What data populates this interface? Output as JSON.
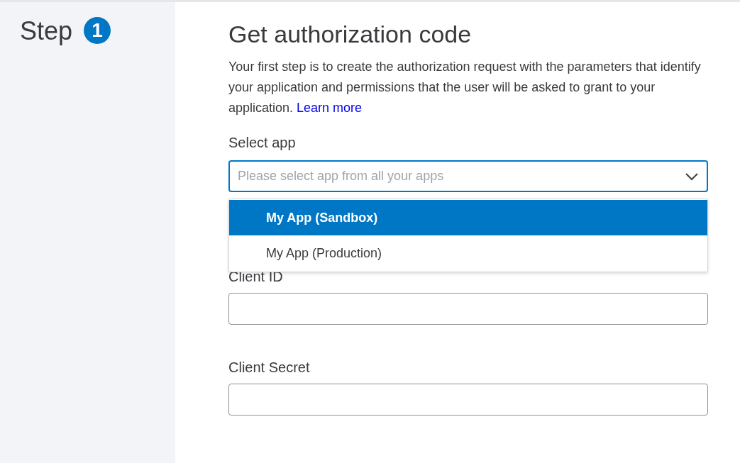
{
  "sidebar": {
    "step_label": "Step",
    "step_number": "1"
  },
  "heading": "Get authorization code",
  "intro": {
    "text": "Your first step is to create the authorization request with the parameters that identify your application and permissions that the user will be asked to grant to your application.",
    "link": "Learn more"
  },
  "select_app": {
    "label": "Select app",
    "placeholder": "Please select app from all your apps",
    "expanded": true,
    "options": [
      {
        "label": "My App (Sandbox)",
        "selected": true
      },
      {
        "label": "My App (Production)",
        "selected": false
      }
    ]
  },
  "fields": [
    {
      "label": "Client ID"
    },
    {
      "label": "Client Secret"
    }
  ]
}
